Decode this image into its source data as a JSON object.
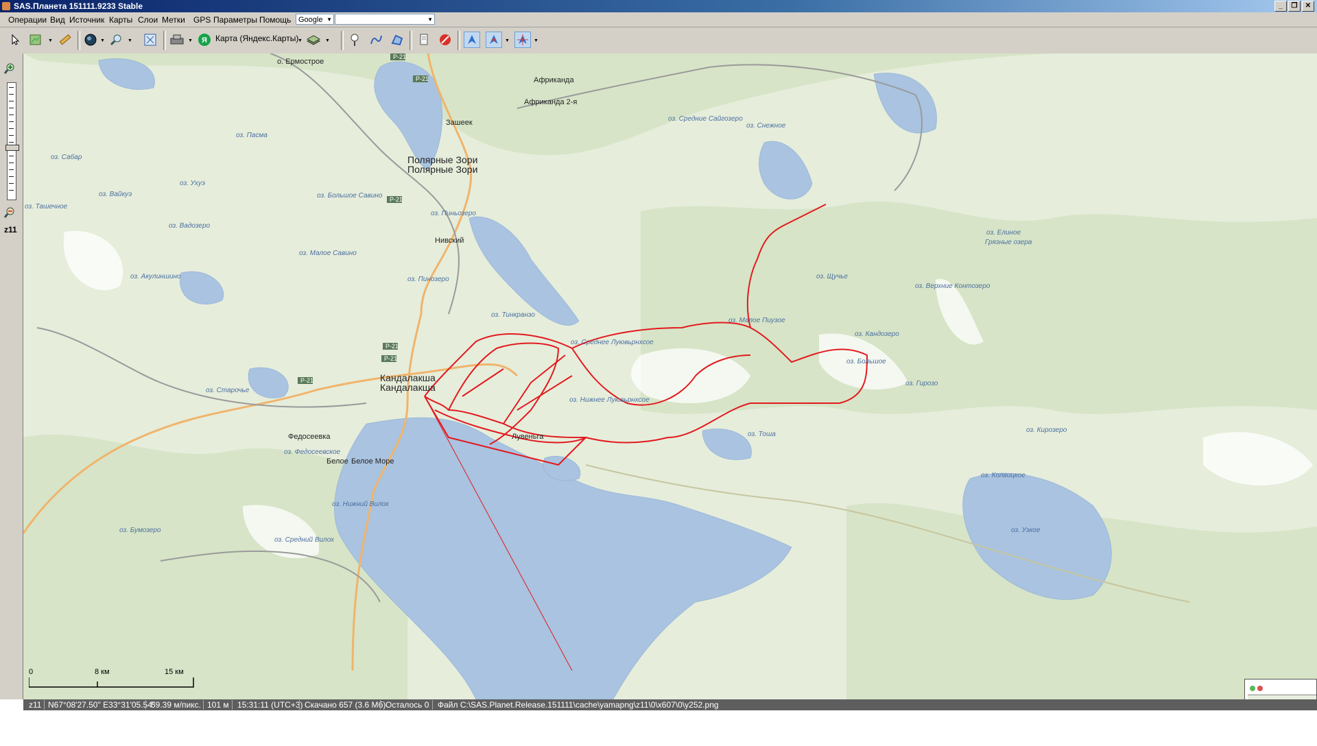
{
  "window": {
    "title": "SAS.Планета 151111.9233 Stable",
    "controls": [
      "_",
      "❐",
      "✕"
    ]
  },
  "menu": {
    "items": [
      "Операции",
      "Вид",
      "Источник",
      "Карты",
      "Слои",
      "Метки",
      "GPS",
      "Параметры",
      "Помощь"
    ],
    "search_provider": "Google",
    "search_value": ""
  },
  "toolbar": {
    "map_source": "Карта (Яндекс.Карты)",
    "icons": [
      "cursor-icon",
      "layers-icon",
      "ruler-icon",
      "globe-icon",
      "zoom-icon",
      "fullscreen-icon",
      "gps-device-icon",
      "yandex-logo-icon",
      "map-layer-icon",
      "placemark-icon",
      "path-icon",
      "polygon-icon",
      "marks-list-icon",
      "delete-marks-icon",
      "gps-track-icon",
      "gps-center-icon",
      "gps-follow-icon"
    ]
  },
  "left_panel": {
    "zoom_label": "z11"
  },
  "map": {
    "cities": [
      {
        "name": "Полярные Зори",
        "name2": "Полярные Зори"
      },
      {
        "name": "Кандалакша",
        "name2": "Кандалакша"
      }
    ],
    "places": [
      "о. Ермострое",
      "Африканда",
      "Африканда 2-я",
      "Зашеек",
      "Нивский",
      "Федосеевка",
      "Белое",
      "Белое Море",
      "Лувеньга"
    ],
    "lakes": [
      "оз. Пасма",
      "оз. Сабар",
      "оз. Ухуэ",
      "оз. Вайкуэ",
      "оз. Ташечное",
      "оз. Вадозеро",
      "оз. Большое Савино",
      "оз. Пиньозеро",
      "оз. Малое Савино",
      "оз. Акулиншино",
      "оз. Пинозеро",
      "оз. Тинкранзо",
      "оз. Среднее Луювьрнхсое",
      "оз. Нижнее Луювьрнхсое",
      "оз. Старочье",
      "оз. Федосеевское",
      "оз. Нижний Вилох",
      "оз. Бумозеро",
      "оз. Средний Вилох",
      "оз. Средние Сайгозеро",
      "оз. Снежное",
      "оз. Малое Пиузое",
      "оз. Кандозеро",
      "оз. Большое",
      "оз. Тоша",
      "оз. Колвицкое",
      "оз. Узкое",
      "оз. Верхние Контозеро",
      "оз. Елиное",
      "оз. Щучье",
      "оз. Гирозо",
      "оз. Кирозеро",
      "Грязные озера"
    ],
    "road_signs": [
      "P-21",
      "P-21",
      "P-21",
      "P-21",
      "P-21",
      "P-21"
    ],
    "scale": {
      "labels": [
        "0",
        "8 км",
        "15 км"
      ]
    },
    "colors": {
      "water": "#a9c3e0",
      "land": "#e8eedd",
      "forest": "#d6e3c5",
      "track": "#e3191e",
      "highway": "#f0b46c",
      "railway": "#9a9a9a"
    }
  },
  "status": {
    "zoom": "z11",
    "coords": "N67°08'27.50\" E33°31'05.54\"",
    "resolution": "59.39 м/пикс.",
    "altitude": "101 м",
    "time": "15:31:11 (UTC+3)",
    "downloaded": "Скачано 657 (3.6 Мб)",
    "remaining": "Осталось 0",
    "file": "Файл C:\\SAS.Planet.Release.151111\\cache\\yamapng\\z11\\0\\x607\\0\\y252.png"
  }
}
